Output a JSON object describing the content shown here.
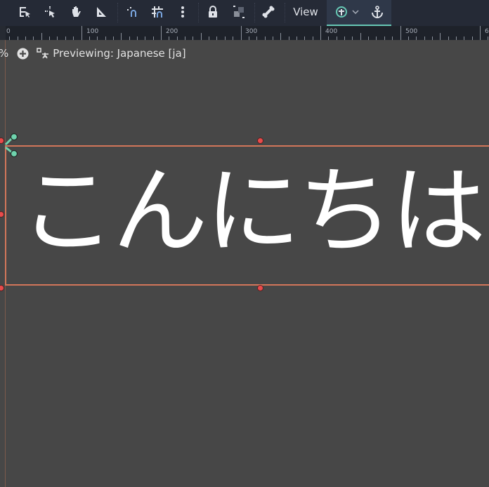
{
  "toolbar": {
    "tools": [
      "list-select-icon",
      "select-icon",
      "pan-icon",
      "ruler-icon",
      "smart-snap-icon",
      "grid-snap-icon",
      "more-icon",
      "lock-icon",
      "group-icon",
      "bone-icon"
    ],
    "view_label": "View",
    "anchor_group": [
      "anchor-preset-icon",
      "chevron-down-icon",
      "anchor-icon"
    ],
    "accent": "#67c8b5"
  },
  "ruler": {
    "labels": [
      "0",
      "100",
      "200",
      "300",
      "400",
      "500",
      "6"
    ]
  },
  "status": {
    "zoom_suffix": "%",
    "preview_text": "Previewing: Japanese [ja]"
  },
  "canvas": {
    "label_text": "こんにちは",
    "selection_color": "#d2765a",
    "background": "#474747"
  }
}
